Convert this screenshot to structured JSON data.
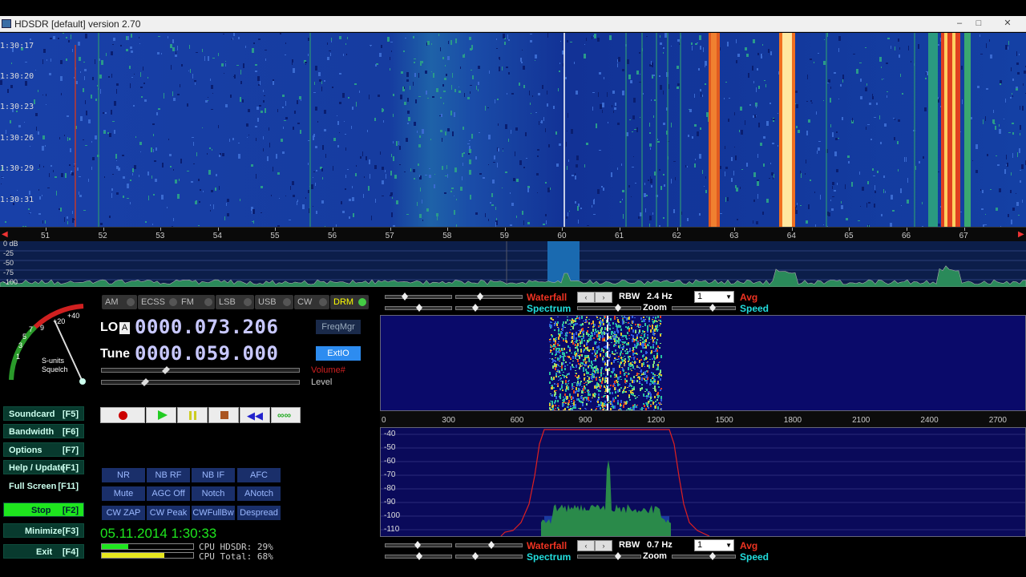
{
  "window": {
    "title": "HDSDR [default]  version 2.70",
    "buttons": [
      "–",
      "□",
      "✕"
    ]
  },
  "waterfall": {
    "times": [
      "1:30:17",
      "1:30:20",
      "1:30:23",
      "1:30:26",
      "1:30:29",
      "1:30:31"
    ]
  },
  "freq_scale": {
    "ticks": [
      "51",
      "52",
      "53",
      "54",
      "55",
      "56",
      "57",
      "58",
      "59",
      "60",
      "61",
      "62",
      "63",
      "64",
      "65",
      "66",
      "67"
    ]
  },
  "top_spectrum": {
    "db_labels": [
      "0 dB",
      "-25",
      "-50",
      "-75",
      "-100"
    ]
  },
  "smeter": {
    "scale": [
      "1",
      "3",
      "5",
      "7",
      "9",
      "+20",
      "+40"
    ],
    "caption_line1": "S-units",
    "caption_line2": "Squelch"
  },
  "modes": [
    {
      "label": "AM",
      "active": false
    },
    {
      "label": "ECSS",
      "active": false
    },
    {
      "label": "FM",
      "active": false
    },
    {
      "label": "LSB",
      "active": false
    },
    {
      "label": "USB",
      "active": false
    },
    {
      "label": "CW",
      "active": false
    },
    {
      "label": "DRM",
      "active": true
    }
  ],
  "lo": {
    "label": "LO",
    "sub": "A",
    "value": "0000.073.206"
  },
  "tune": {
    "label": "Tune",
    "value": "0000.059.000"
  },
  "freqmgr_label": "FreqMgr",
  "extio_label": "ExtIO",
  "volume_label": "Volume#",
  "level_label": "Level",
  "function_keys": [
    {
      "label": "Soundcard",
      "key": "[F5]"
    },
    {
      "label": "Bandwidth",
      "key": "[F6]"
    },
    {
      "label": "Options",
      "key": "[F7]"
    },
    {
      "label": "Help / Update",
      "key": "[F1]"
    },
    {
      "label": "Full Screen",
      "key": "[F11]"
    },
    {
      "label": "Stop",
      "key": "[F2]"
    },
    {
      "label": "Minimize",
      "key": "[F3]"
    },
    {
      "label": "Exit",
      "key": "[F4]"
    }
  ],
  "dsp_buttons": [
    [
      "NR",
      "NB RF",
      "NB IF",
      "AFC"
    ],
    [
      "Mute",
      "AGC Off",
      "Notch",
      "ANotch"
    ],
    [
      "CW ZAP",
      "CW Peak",
      "CWFullBw",
      "Despread"
    ]
  ],
  "datetime": "05.11.2014 1:30:33",
  "cpu": {
    "hdsdr": "CPU HDSDR: 29%",
    "total": "CPU Total: 68%",
    "hdsdr_fraction": 0.29,
    "total_fraction": 0.68
  },
  "upper_controls": {
    "waterfall_label": "Waterfall",
    "spectrum_label": "Spectrum",
    "rbw_label": "RBW",
    "rbw_value": "2.4 Hz",
    "zoom_label": "Zoom",
    "avg_label": "Avg",
    "speed_label": "Speed",
    "avg_value": "1"
  },
  "lower_controls": {
    "waterfall_label": "Waterfall",
    "spectrum_label": "Spectrum",
    "rbw_label": "RBW",
    "rbw_value": "0.7 Hz",
    "zoom_label": "Zoom",
    "avg_label": "Avg",
    "speed_label": "Speed",
    "avg_value": "1"
  },
  "audio_scale": {
    "ticks": [
      "0",
      "300",
      "600",
      "900",
      "1200",
      "1500",
      "1800",
      "2100",
      "2400",
      "2700"
    ]
  },
  "audio_spectrum": {
    "db_labels": [
      "-40",
      "-50",
      "-60",
      "-70",
      "-80",
      "-90",
      "-100",
      "-110"
    ]
  },
  "colors": {
    "accent_green": "#1ee61e",
    "panel_blue": "#1a2f6a",
    "waterfall_bg": "#0b2a8a",
    "extio": "#2d8cf0"
  }
}
